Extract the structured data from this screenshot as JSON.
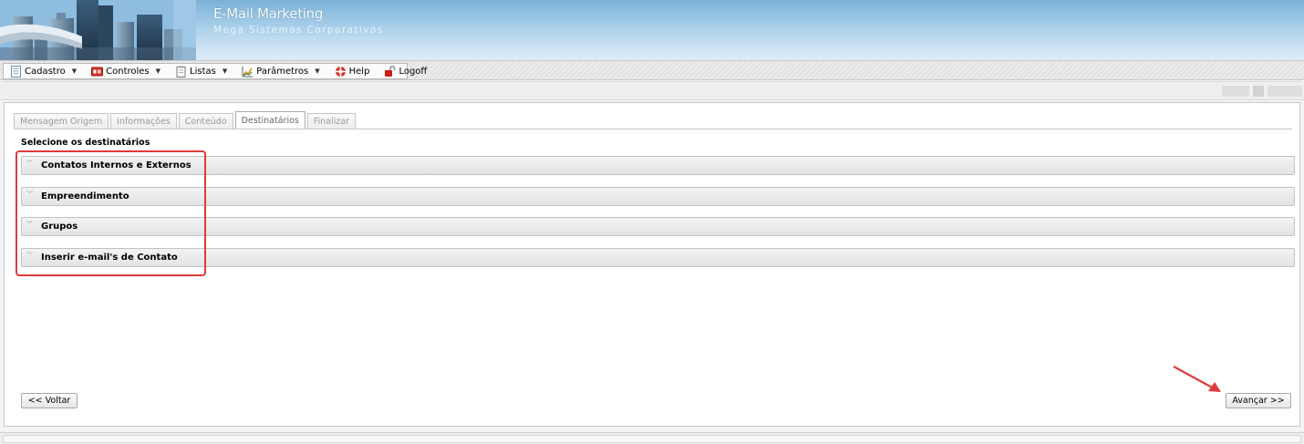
{
  "header": {
    "title": "E-Mail Marketing",
    "subtitle": "Mega Sistemas Corporativos"
  },
  "menu": {
    "items": [
      {
        "label": "Cadastro",
        "icon": "document-icon",
        "has_dropdown": true
      },
      {
        "label": "Controles",
        "icon": "controls-icon",
        "has_dropdown": true
      },
      {
        "label": "Listas",
        "icon": "clipboard-icon",
        "has_dropdown": true
      },
      {
        "label": "Parâmetros",
        "icon": "chart-icon",
        "has_dropdown": true
      },
      {
        "label": "Help",
        "icon": "lifebuoy-icon",
        "has_dropdown": false
      },
      {
        "label": "Logoff",
        "icon": "padlock-icon",
        "has_dropdown": false
      }
    ]
  },
  "wizard": {
    "tabs": [
      {
        "label": "Mensagem Origem",
        "active": false
      },
      {
        "label": "Informações",
        "active": false
      },
      {
        "label": "Conteúdo",
        "active": false
      },
      {
        "label": "Destinatários",
        "active": true
      },
      {
        "label": "Finalizar",
        "active": false
      }
    ],
    "section_label": "Selecione os destinatários",
    "panels": [
      {
        "title": "Contatos Internos e Externos"
      },
      {
        "title": "Empreendimento"
      },
      {
        "title": "Grupos"
      },
      {
        "title": "Inserir e-mail's de Contato"
      }
    ],
    "back_label": "<< Voltar",
    "next_label": "Avançar >>"
  },
  "colors": {
    "highlight": "#e03a3a",
    "header_sky": "#7ab1d8",
    "panel_bg": "#e8e8e8"
  }
}
